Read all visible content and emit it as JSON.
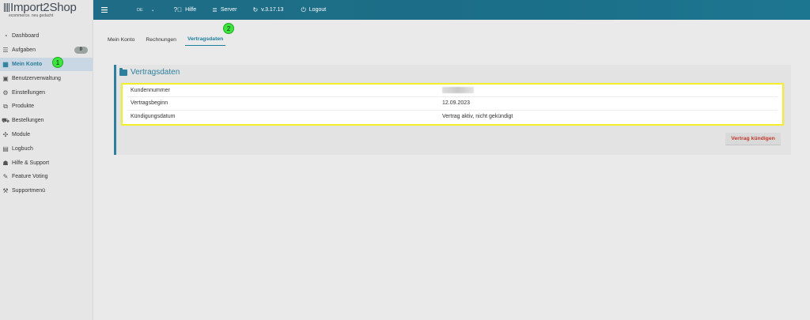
{
  "logo": {
    "name": "Import2Shop",
    "tagline": "ecommerce. neu gedacht"
  },
  "topbar": {
    "menu_icon": "hamburger-icon",
    "language": "DE",
    "help": "Hilfe",
    "server": "Server",
    "version": "v.3.17.13",
    "logout": "Logout"
  },
  "sidebar": {
    "items": [
      {
        "label": "Dashboard",
        "icon": "gauge-icon"
      },
      {
        "label": "Aufgaben",
        "icon": "list-icon",
        "badge": "0"
      },
      {
        "label": "Mein Konto",
        "icon": "account-icon",
        "active": true
      },
      {
        "label": "Benutzerverwaltung",
        "icon": "users-icon"
      },
      {
        "label": "Einstellungen",
        "icon": "gears-icon"
      },
      {
        "label": "Produkte",
        "icon": "boxes-icon"
      },
      {
        "label": "Bestellungen",
        "icon": "cart-icon"
      },
      {
        "label": "Module",
        "icon": "modules-icon"
      },
      {
        "label": "Logbuch",
        "icon": "log-icon"
      },
      {
        "label": "Hilfe & Support",
        "icon": "support-icon"
      },
      {
        "label": "Feature Voting",
        "icon": "vote-icon"
      },
      {
        "label": "Supportmenü",
        "icon": "wrench-icon"
      }
    ]
  },
  "tabs": [
    {
      "label": "Mein Konto"
    },
    {
      "label": "Rechnungen"
    },
    {
      "label": "Vertragsdaten",
      "active": true
    }
  ],
  "markers": {
    "m1": "1",
    "m2": "2"
  },
  "panel": {
    "title": "Vertragsdaten",
    "rows": [
      {
        "key": "Kundennummer",
        "value": ""
      },
      {
        "key": "Vertragsbeginn",
        "value": "12.09.2023"
      },
      {
        "key": "Kündigungsdatum",
        "value": "Vertrag aktiv, nicht gekündigt"
      }
    ],
    "cancel_button": "Vertrag kündigen"
  },
  "colors": {
    "accent": "#1f7d9e",
    "highlight": "#f2ee29",
    "danger": "#c0392b",
    "marker": "#3ce63c"
  }
}
